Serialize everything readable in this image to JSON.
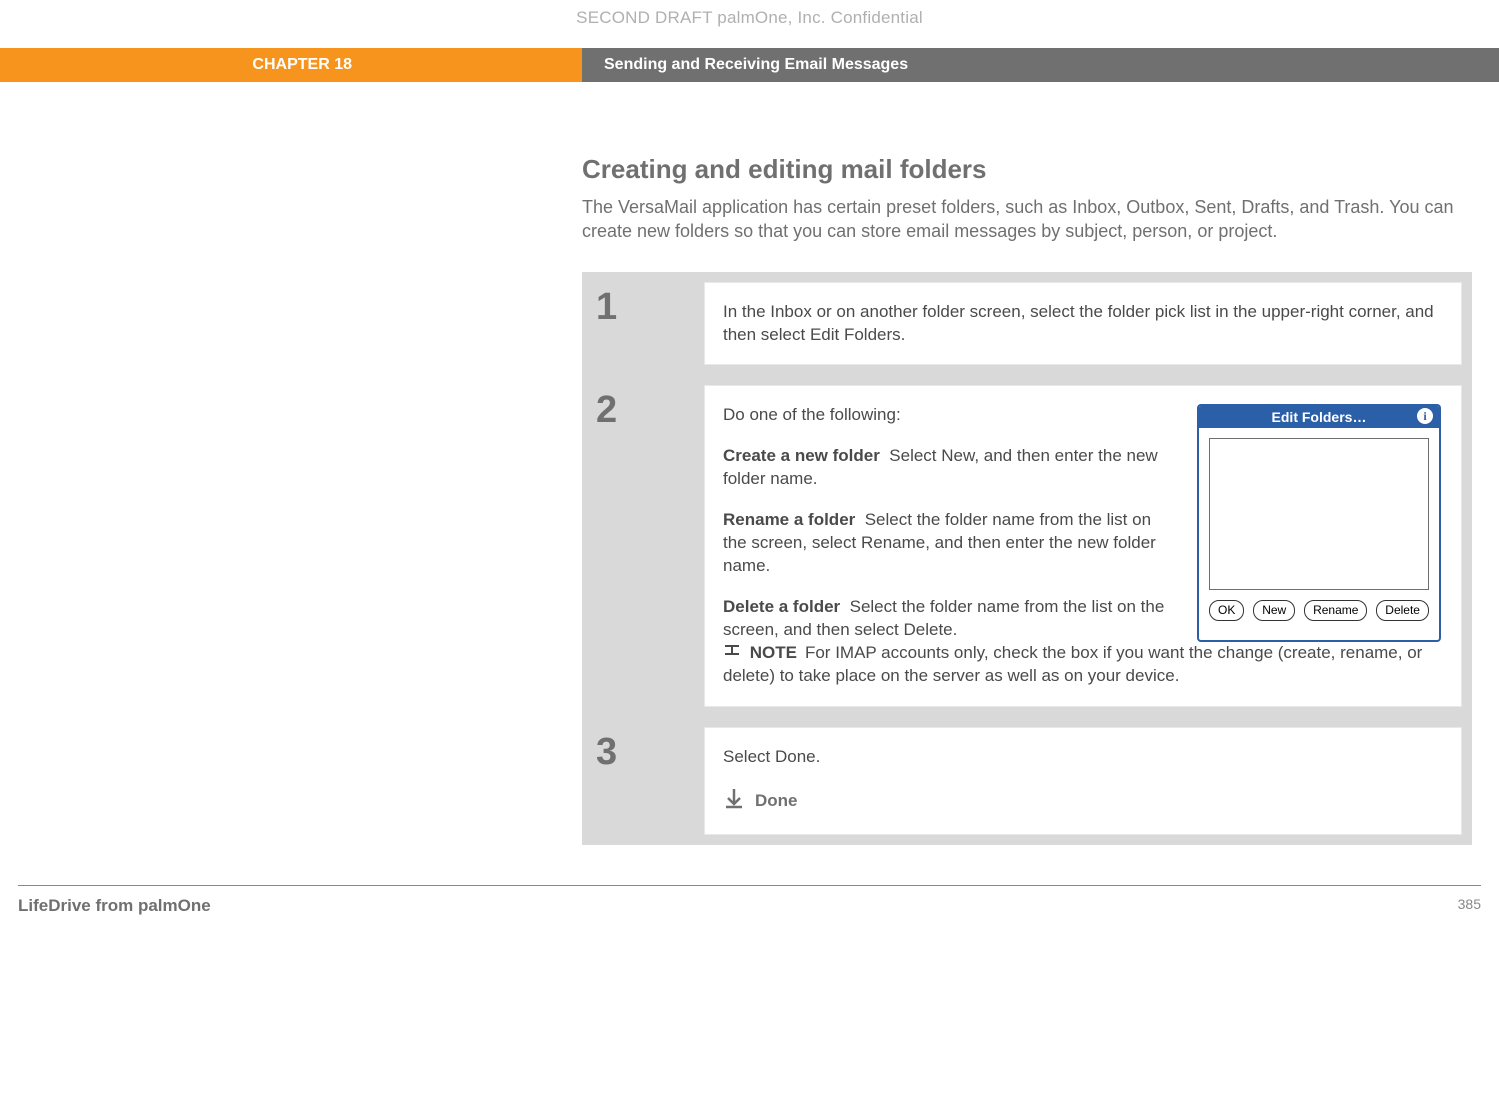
{
  "watermark": "SECOND DRAFT palmOne, Inc.  Confidential",
  "header": {
    "chapter": "CHAPTER 18",
    "title": "Sending and Receiving Email Messages"
  },
  "section": {
    "heading": "Creating and editing mail folders",
    "lead": "The VersaMail application has certain preset folders, such as Inbox, Outbox, Sent, Drafts, and Trash. You can create new folders so that you can store email messages by subject, person, or project."
  },
  "steps": [
    {
      "num": "1",
      "body": "In the Inbox or on another folder screen, select the folder pick list in the upper-right corner, and then select Edit Folders."
    },
    {
      "num": "2",
      "intro": "Do one of the following:",
      "items": [
        {
          "label": "Create a new folder",
          "text": "Select New, and then enter the new folder name."
        },
        {
          "label": "Rename a folder",
          "text": "Select the folder name from the list on the screen, select Rename, and then enter the new folder name."
        },
        {
          "label": "Delete a folder",
          "text": "Select the folder name from the list on the screen, and then select Delete."
        }
      ],
      "note_label": "NOTE",
      "note_text": "For IMAP accounts only, check the box if you want the change (create, rename, or delete) to take place on the server as well as on your device.",
      "dialog": {
        "title": "Edit Folders…",
        "buttons": [
          "OK",
          "New",
          "Rename",
          "Delete"
        ]
      }
    },
    {
      "num": "3",
      "body": "Select Done.",
      "done_label": "Done"
    }
  ],
  "footer": {
    "product": "LifeDrive from palmOne",
    "page": "385"
  }
}
